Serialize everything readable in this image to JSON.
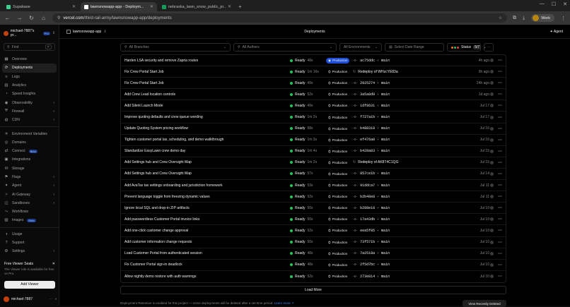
{
  "browser": {
    "tabs": [
      {
        "title": "Supabase",
        "color": "#3ecf8e"
      },
      {
        "title": "lawnsnowapp-app - Deploym...",
        "color": "#ffffff",
        "active": true
      },
      {
        "title": "nebraska_lawn_snow_public_pr...",
        "color": "#0f9d58"
      }
    ],
    "url_host": "vercel.com",
    "url_path": "/third-rail-army/lawnsnowapp-app/deployments",
    "profile_label": "Work"
  },
  "sidebar": {
    "team_name": "michael-7887's pr...",
    "team_badge": "Pro",
    "find_placeholder": "Find",
    "find_shortcut": "F",
    "items": [
      {
        "label": "Overview",
        "icon": "grid-icon",
        "glyph": "▦"
      },
      {
        "label": "Deployments",
        "icon": "rocket-icon",
        "glyph": "⟳",
        "active": true
      },
      {
        "label": "Logs",
        "icon": "logs-icon",
        "glyph": "≡"
      },
      {
        "label": "Analytics",
        "icon": "chart-icon",
        "glyph": "▥"
      },
      {
        "label": "Speed Insights",
        "icon": "gauge-icon",
        "glyph": "◔"
      },
      {
        "label": "Observability",
        "icon": "eye-icon",
        "glyph": "◉",
        "chevron": true
      },
      {
        "label": "Firewall",
        "icon": "shield-icon",
        "glyph": "⛨",
        "chevron": true
      },
      {
        "label": "CDN",
        "icon": "globe-icon",
        "glyph": "◍",
        "chevron": true
      }
    ],
    "items2": [
      {
        "label": "Environment Variables",
        "icon": "variables-icon",
        "glyph": "✳"
      },
      {
        "label": "Domains",
        "icon": "domain-icon",
        "glyph": "◎"
      },
      {
        "label": "Connect",
        "icon": "connect-icon",
        "glyph": "⇄",
        "badge": "Beta"
      },
      {
        "label": "Integrations",
        "icon": "puzzle-icon",
        "glyph": "▣"
      },
      {
        "label": "Storage",
        "icon": "database-icon",
        "glyph": "⛁"
      },
      {
        "label": "Flags",
        "icon": "flag-icon",
        "glyph": "⚑",
        "chevron": true
      },
      {
        "label": "Agent",
        "icon": "agent-icon",
        "glyph": "✦",
        "chevron": true
      },
      {
        "label": "AI Gateway",
        "icon": "ai-gateway-icon",
        "glyph": "✧",
        "chevron": true
      },
      {
        "label": "Sandboxes",
        "icon": "sandbox-icon",
        "glyph": "◫",
        "chevron": true
      },
      {
        "label": "Workflows",
        "icon": "workflow-icon",
        "glyph": "⤳"
      },
      {
        "label": "Images",
        "icon": "image-icon",
        "glyph": "▨",
        "badge": "Beta"
      }
    ],
    "items3": [
      {
        "label": "Usage",
        "icon": "usage-icon",
        "glyph": "◑"
      },
      {
        "label": "Support",
        "icon": "support-icon",
        "glyph": "?"
      },
      {
        "label": "Settings",
        "icon": "gear-icon",
        "glyph": "⚙",
        "chevron": true
      }
    ],
    "promo": {
      "title": "Free Viewer Seats",
      "text": "The Viewer role is available for free on Pro.",
      "button": "Add Viewer"
    },
    "user_name": "michael-7887"
  },
  "header": {
    "project": "lawnsnowapp-app",
    "title": "Deployments",
    "agent": "Agent"
  },
  "filters": {
    "branches": "All Branches",
    "authors": "All Authors",
    "environments": "All Environments",
    "date": "Select Date Range",
    "status_label": "Status",
    "status_count": "5/7",
    "status_colors": [
      "#f97316",
      "#22c55e",
      "#ef4444"
    ]
  },
  "deployments": [
    {
      "msg": "Harden LSA security and remove Zapria routes",
      "status": "Ready",
      "dur": "48s",
      "env": "Production",
      "current": true,
      "commit": "ac75ddc",
      "branch": "main",
      "age": "4h ago"
    },
    {
      "msg": "Fix Crew Portal Start Job",
      "status": "Ready",
      "dur": "1m 16s",
      "env": "Production",
      "redeploy": "Redeploy of WHzcYE83a",
      "age": "9h ago"
    },
    {
      "msg": "Fix Crew Portal Start Job",
      "status": "Ready",
      "dur": "49s",
      "env": "Production",
      "commit": "2925274",
      "branch": "main",
      "age": "24h ago"
    },
    {
      "msg": "Add Crew Lead location controls",
      "status": "Ready",
      "dur": "52s",
      "env": "Production",
      "commit": "3a5a8d9",
      "branch": "main",
      "age": "1d ago"
    },
    {
      "msg": "Add Silent Launch Mode",
      "status": "Ready",
      "dur": "49s",
      "env": "Production",
      "commit": "1df8631",
      "branch": "main",
      "age": "Jul 17"
    },
    {
      "msg": "Improve quoting defaults and crew queue wording",
      "status": "Ready",
      "dur": "1m 2s",
      "env": "Production",
      "commit": "f727a1b",
      "branch": "main",
      "age": "Jul 17"
    },
    {
      "msg": "Update Quoting System pricing workflow",
      "status": "Ready",
      "dur": "58s",
      "env": "Production",
      "commit": "b488318",
      "branch": "main",
      "age": "Jul 16"
    },
    {
      "msg": "Tighten customer portal tax, scheduling, and demo walkthrough",
      "status": "Ready",
      "dur": "1m 3s",
      "env": "Production",
      "commit": "ef476a0",
      "branch": "main",
      "age": "Jul 16"
    },
    {
      "msg": "Standardize EasyLawn crew demo day",
      "status": "Ready",
      "dur": "1m 4s",
      "env": "Production",
      "commit": "b428a83",
      "branch": "main",
      "age": "Jul 15"
    },
    {
      "msg": "Add Settings hub and Crew Oversight Map",
      "status": "Ready",
      "dur": "1m 2s",
      "env": "Production",
      "redeploy": "Redeploy of AK8T4C1QG",
      "age": "Jul 15"
    },
    {
      "msg": "Add Settings hub and Crew Oversight Map",
      "status": "Ready",
      "dur": "57s",
      "env": "Production",
      "commit": "857ce1b",
      "branch": "main",
      "age": "Jul 14"
    },
    {
      "msg": "Add AvaTax tax settings onboarding and jurisdiction homework",
      "status": "Ready",
      "dur": "53s",
      "env": "Production",
      "commit": "91ddca7",
      "branch": "main",
      "age": "Jul 11"
    },
    {
      "msg": "Prevent language toggle from freezing dynamic values",
      "status": "Ready",
      "dur": "52s",
      "env": "Production",
      "commit": "b2b48e8",
      "branch": "main",
      "age": "Jul 11"
    },
    {
      "msg": "Ignore local SQL and drop-in ZIP artifacts",
      "status": "Ready",
      "dur": "50s",
      "env": "Production",
      "commit": "b288e18",
      "branch": "main",
      "age": "Jul 10"
    },
    {
      "msg": "Add passwordless Customer Portal invoice links",
      "status": "Ready",
      "dur": "50s",
      "env": "Production",
      "commit": "17a43db",
      "branch": "main",
      "age": "Jul 10"
    },
    {
      "msg": "Add one-click customer change approval",
      "status": "Ready",
      "dur": "52s",
      "env": "Production",
      "commit": "eea5f85",
      "branch": "main",
      "age": "Jul 10"
    },
    {
      "msg": "Add customer information change requests",
      "status": "Ready",
      "dur": "50s",
      "env": "Production",
      "commit": "73f571b",
      "branch": "main",
      "age": "Jul 10"
    },
    {
      "msg": "Load Customer Portal from authenticated session",
      "status": "Ready",
      "dur": "48s",
      "env": "Production",
      "commit": "7a2518a",
      "branch": "main",
      "age": "Jul 10"
    },
    {
      "msg": "Fix Customer Portal sign-in deadlock",
      "status": "Ready",
      "dur": "48s",
      "env": "Production",
      "commit": "2f5d7bc",
      "branch": "main",
      "age": "Jul 10"
    },
    {
      "msg": "Allow nightly demo restore with auth warnings",
      "status": "Ready",
      "dur": "52s",
      "env": "Production",
      "commit": "273e814",
      "branch": "main",
      "age": "Jul 10"
    }
  ],
  "load_more": "Load More",
  "footnote": "Deployment Retention is enabled for this project — some deployments will be deleted after a set time period.",
  "footnote_link": "Learn more",
  "view_button": "View Recently Deleted"
}
